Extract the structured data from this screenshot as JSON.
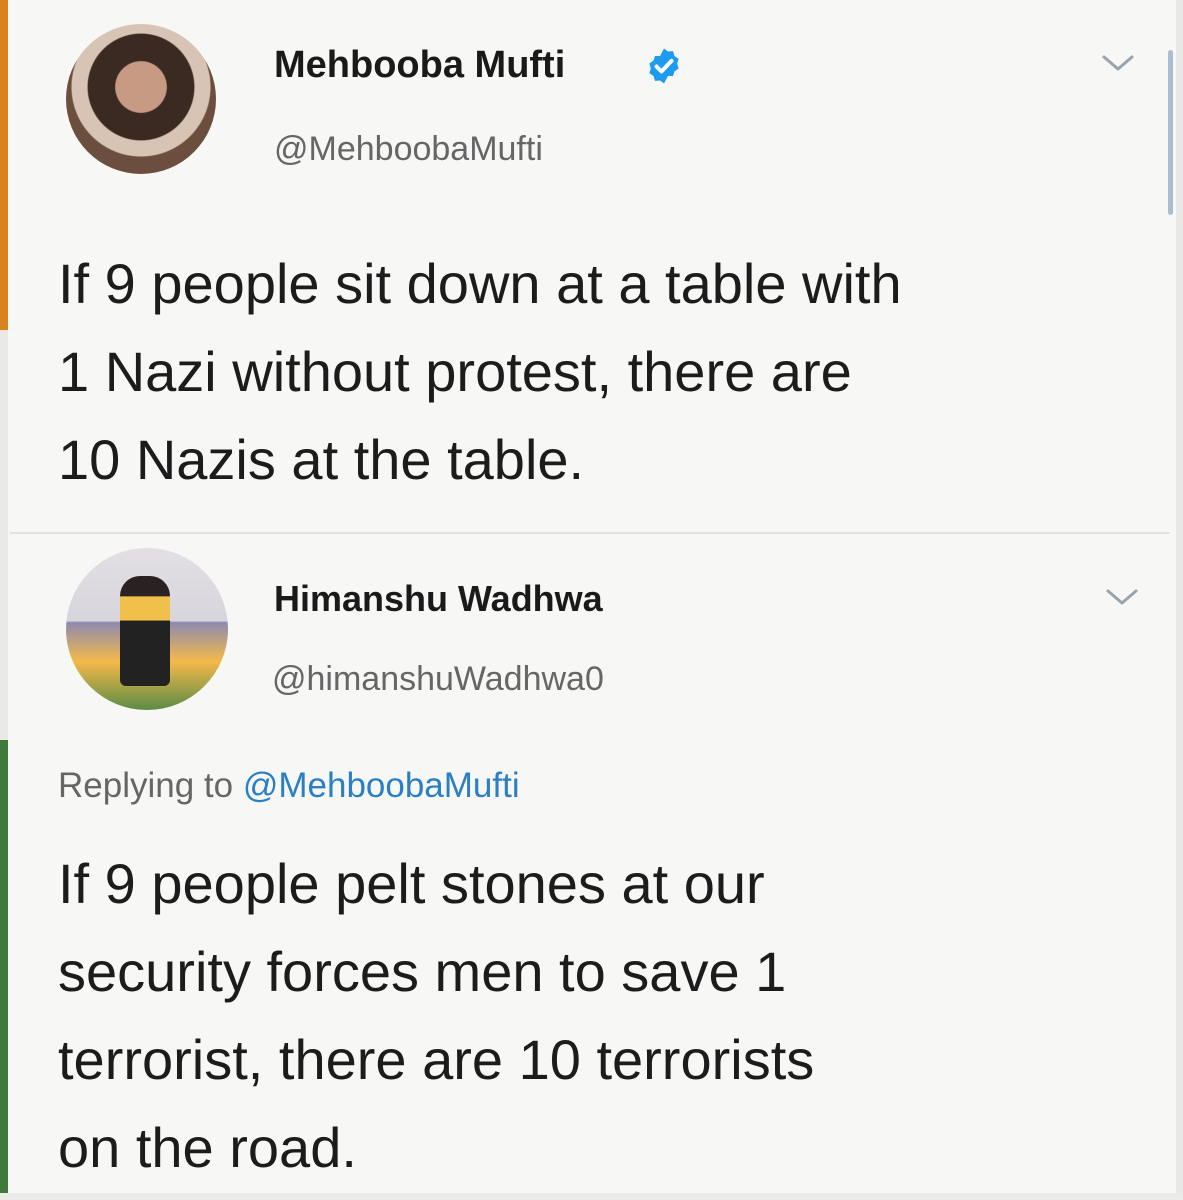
{
  "tweet1": {
    "author_name": "Mehbooba Mufti",
    "verified_icon": "verified-badge-icon",
    "handle": "@MehboobaMufti",
    "text_lines": [
      "If 9 people sit down at a table with",
      "1 Nazi without protest, there are",
      "10 Nazis at the table."
    ]
  },
  "tweet2": {
    "author_name": "Himanshu Wadhwa",
    "handle": "@himanshuWadhwa0",
    "replying_prefix": "Replying to ",
    "replying_handle": "@MehboobaMufti",
    "text_lines": [
      "If 9 people pelt stones at our",
      "security forces men to save 1",
      "terrorist, there are 10 terrorists",
      "on the road."
    ]
  },
  "colors": {
    "link_blue": "#2a7fc5",
    "verified_blue": "#1d9bf0",
    "handle_gray": "#666666"
  },
  "icons": {
    "menu": "chevron-down-icon",
    "verified": "verified-badge-icon"
  }
}
